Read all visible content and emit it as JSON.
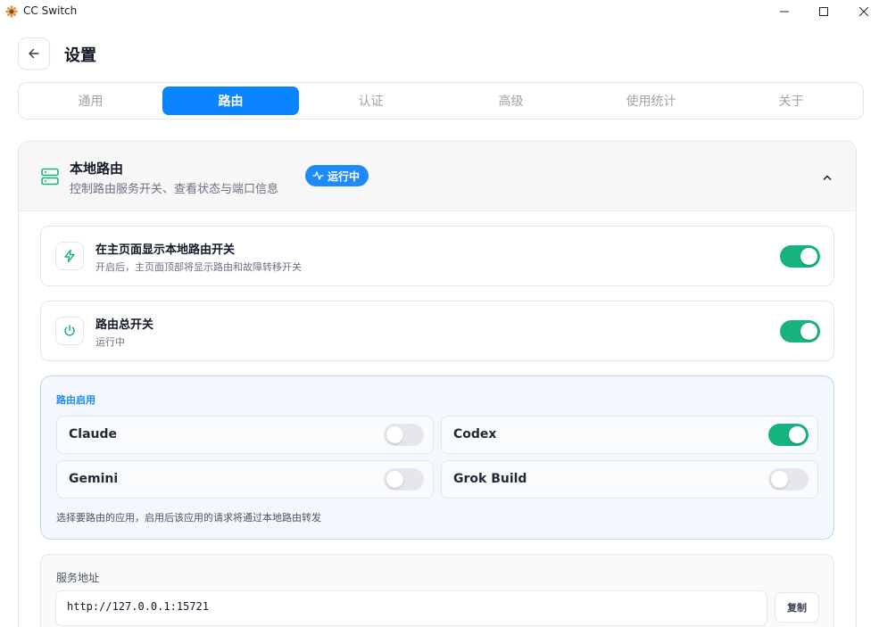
{
  "window": {
    "title": "CC Switch",
    "icon": "sunflower-app-icon",
    "controls": [
      "minimize-icon",
      "maximize-icon",
      "close-icon"
    ]
  },
  "header": {
    "back_icon": "arrow-left-icon",
    "title": "设置"
  },
  "tabs": [
    {
      "label": "通用",
      "active": false
    },
    {
      "label": "路由",
      "active": true
    },
    {
      "label": "认证",
      "active": false
    },
    {
      "label": "高级",
      "active": false
    },
    {
      "label": "使用统计",
      "active": false
    },
    {
      "label": "关于",
      "active": false
    }
  ],
  "section": {
    "icon": "server-icon",
    "title": "本地路由",
    "subtitle": "控制路由服务开关、查看状态与端口信息",
    "badge": "运行中",
    "badge_icon": "activity-icon",
    "collapse_icon": "chevron-up-icon"
  },
  "rows": [
    {
      "icon": "lightning-icon",
      "title": "在主页面显示本地路由开关",
      "subtitle": "开启后，主页面顶部将显示路由和故障转移开关",
      "enabled": true
    },
    {
      "icon": "power-icon",
      "title": "路由总开关",
      "subtitle": "运行中",
      "enabled": true
    }
  ],
  "routing_enable": {
    "title": "路由启用",
    "apps": [
      {
        "name": "Claude",
        "enabled": false
      },
      {
        "name": "Codex",
        "enabled": true
      },
      {
        "name": "Gemini",
        "enabled": false
      },
      {
        "name": "Grok Build",
        "enabled": false
      }
    ],
    "hint": "选择要路由的应用，启用后该应用的请求将通过本地路由转发"
  },
  "service_address": {
    "label": "服务地址",
    "value": "http://127.0.0.1:15721",
    "copy_label": "复制"
  },
  "colors": {
    "accent": "#0a84ff",
    "toggle_on": "#16b381",
    "toggle_off": "#e5e7eb",
    "enable_box_bg": "#f3f8fe"
  }
}
